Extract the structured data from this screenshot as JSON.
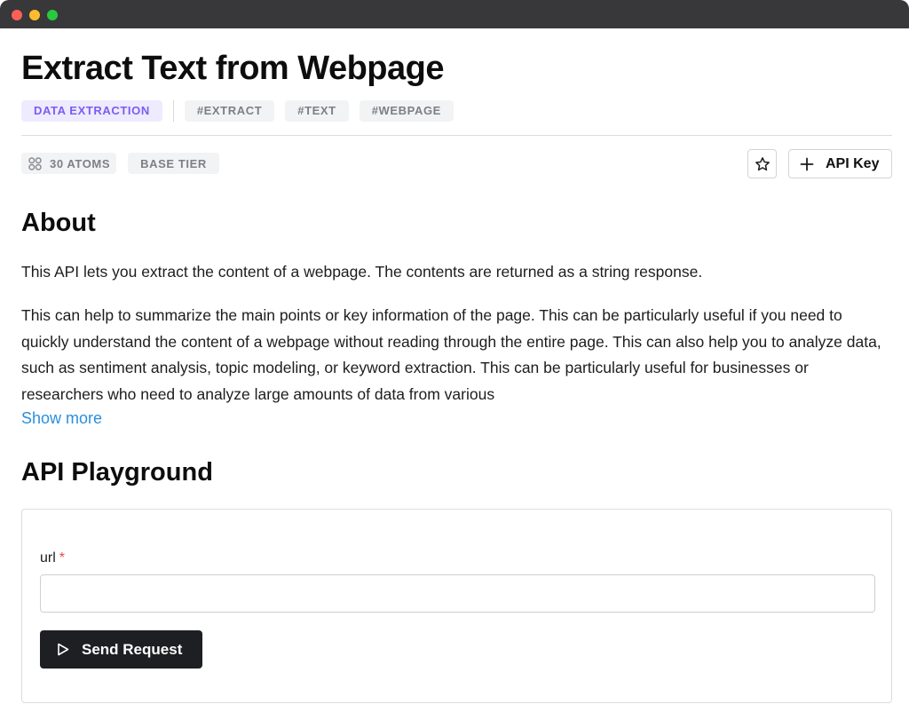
{
  "window": {
    "controls": [
      "close",
      "minimize",
      "maximize"
    ]
  },
  "page": {
    "title": "Extract Text from Webpage",
    "category_tag": "DATA EXTRACTION",
    "hashtags": [
      "#EXTRACT",
      "#TEXT",
      "#WEBPAGE"
    ],
    "atoms_label": "30 ATOMS",
    "atoms_icon": "atom-icon",
    "tier_label": "BASE TIER",
    "favorite_icon": "star-icon",
    "api_key_icon": "plus-icon",
    "api_key_label": "API Key"
  },
  "about": {
    "heading": "About",
    "paragraph1": "This API lets you extract the content of a webpage. The contents are returned as a string response.",
    "paragraph2": "This can help to summarize the main points or key information of the page. This can be particularly useful if you need to quickly understand the content of a webpage without reading through the entire page. This can also help you to analyze data, such as sentiment analysis, topic modeling, or keyword extraction. This can be particularly useful for businesses or researchers who need to analyze large amounts of data from various",
    "show_more": "Show more"
  },
  "playground": {
    "heading": "API Playground",
    "field_label": "url",
    "required_marker": "*",
    "url_value": "",
    "send_icon": "play-icon",
    "send_label": "Send Request"
  },
  "colors": {
    "accent_purple": "#7c5cf0",
    "link_blue": "#2a8fdc",
    "dark_button": "#1e1f22",
    "required_red": "#e5484d"
  }
}
